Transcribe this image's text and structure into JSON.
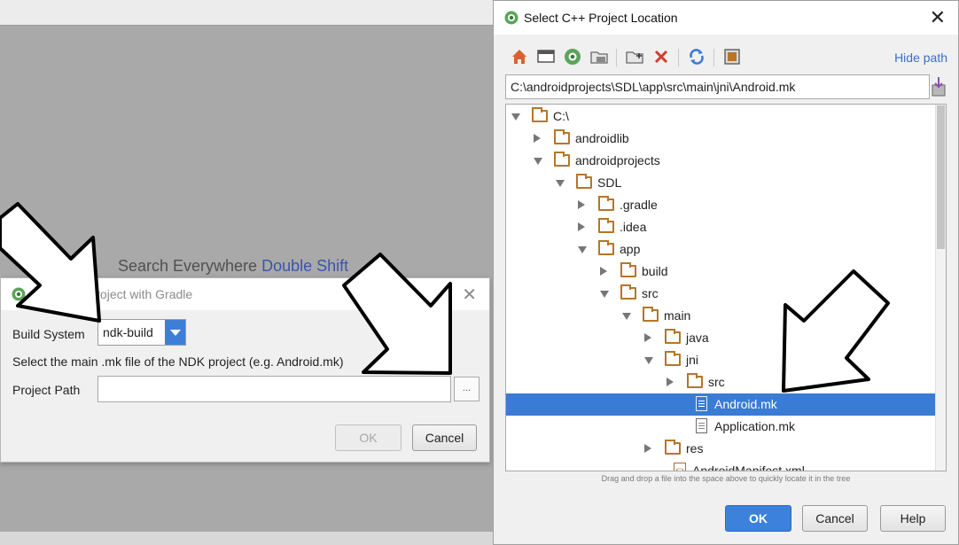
{
  "ide": {
    "search_label": "Search Everywhere",
    "search_shortcut": "Double Shift"
  },
  "gradle_dialog": {
    "title": "Link C++ Project with Gradle",
    "build_system_label": "Build System",
    "build_system_value": "ndk-build",
    "instruction": "Select the main .mk file of the NDK project (e.g. Android.mk)",
    "project_path_label": "Project Path",
    "project_path_value": "",
    "browse_label": "...",
    "ok_label": "OK",
    "cancel_label": "Cancel"
  },
  "location_dialog": {
    "title": "Select C++ Project Location",
    "hide_path_label": "Hide path",
    "path_value": "C:\\androidprojects\\SDL\\app\\src\\main\\jni\\Android.mk",
    "toolbar_icons": [
      "home-icon",
      "desktop-icon",
      "android-project-icon",
      "folder-icon",
      "new-folder-icon",
      "delete-icon",
      "refresh-icon",
      "show-hidden-icon"
    ],
    "tree": [
      {
        "name": "C:\\",
        "depth": 0,
        "expanded": true,
        "kind": "folder"
      },
      {
        "name": "androidlib",
        "depth": 1,
        "expanded": false,
        "kind": "folder"
      },
      {
        "name": "androidprojects",
        "depth": 1,
        "expanded": true,
        "kind": "folder"
      },
      {
        "name": "SDL",
        "depth": 2,
        "expanded": true,
        "kind": "folder"
      },
      {
        "name": ".gradle",
        "depth": 3,
        "expanded": false,
        "kind": "folder"
      },
      {
        "name": ".idea",
        "depth": 3,
        "expanded": false,
        "kind": "folder"
      },
      {
        "name": "app",
        "depth": 3,
        "expanded": true,
        "kind": "folder"
      },
      {
        "name": "build",
        "depth": 4,
        "expanded": false,
        "kind": "folder"
      },
      {
        "name": "src",
        "depth": 4,
        "expanded": true,
        "kind": "folder"
      },
      {
        "name": "main",
        "depth": 5,
        "expanded": true,
        "kind": "folder"
      },
      {
        "name": "java",
        "depth": 6,
        "expanded": false,
        "kind": "folder"
      },
      {
        "name": "jni",
        "depth": 6,
        "expanded": true,
        "kind": "folder"
      },
      {
        "name": "src",
        "depth": 7,
        "expanded": false,
        "kind": "folder"
      },
      {
        "name": "Android.mk",
        "depth": 8,
        "kind": "file",
        "selected": true
      },
      {
        "name": "Application.mk",
        "depth": 8,
        "kind": "file"
      },
      {
        "name": "res",
        "depth": 6,
        "expanded": false,
        "kind": "folder"
      },
      {
        "name": "AndroidManifest.xml",
        "depth": 7,
        "kind": "xml"
      }
    ],
    "hint": "Drag and drop a file into the space above to quickly locate it in the tree",
    "ok_label": "OK",
    "cancel_label": "Cancel",
    "help_label": "Help"
  },
  "colors": {
    "accent": "#3a7bd5",
    "folder": "#b5762a",
    "link": "#3b6ec6"
  }
}
